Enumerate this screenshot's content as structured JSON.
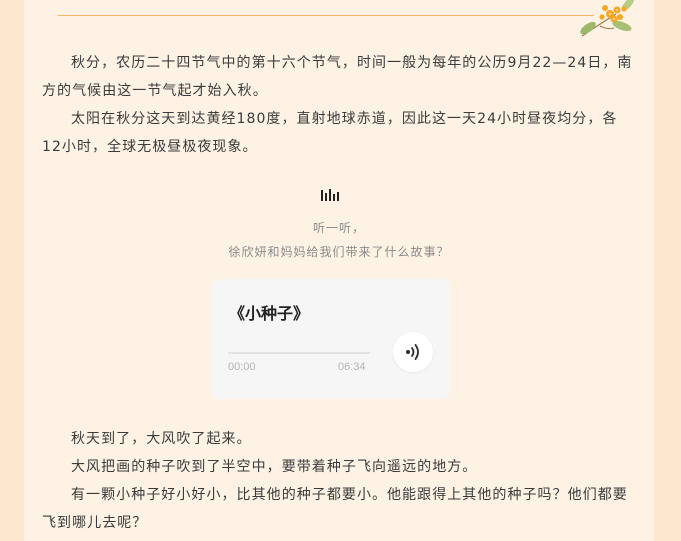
{
  "paragraphs_top": [
    "秋分，农历二十四节气中的第十六个节气，时间一般为每年的公历9月22—24日，南方的气候由这一节气起才始入秋。",
    "太阳在秋分这天到达黄经180度，直射地球赤道，因此这一天24小时昼夜均分，各12小时，全球无极昼极夜现象。"
  ],
  "audio_section": {
    "hint_line1": "听一听，",
    "hint_line2": "徐欣妍和妈妈给我们带来了什么故事？",
    "title": "《小种子》",
    "current_time": "00:00",
    "duration": "06:34",
    "progress": 0
  },
  "paragraphs_bottom": [
    "秋天到了，大风吹了起来。",
    "大风把画的种子吹到了半空中，要带着种子飞向遥远的地方。",
    "有一颗小种子好小好小，比其他的种子都要小。他能跟得上其他的种子吗？他们都要飞到哪儿去呢？"
  ],
  "icons": {
    "decoration": "osmanthus-flower-icon",
    "audio_indicator": "audio-wave-icon",
    "play": "speaker-play-icon"
  },
  "colors": {
    "outer_background": "#fde8cf",
    "page_background": "#fdf2e4",
    "divider": "#f2b36a",
    "flower": "#f5a623"
  }
}
